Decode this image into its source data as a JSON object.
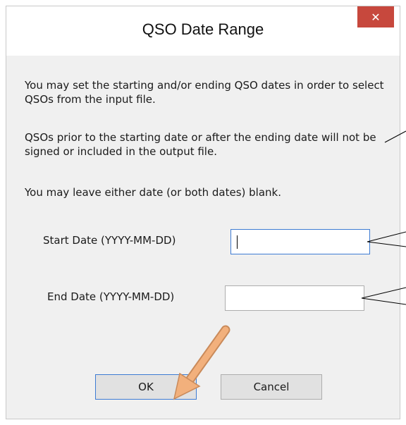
{
  "dialog": {
    "title": "QSO Date Range",
    "close_icon": "close-icon",
    "intro": "You may set the starting and/or ending QSO dates in order to select QSOs from the input file.",
    "explanation": "QSOs prior to the starting date or after the ending date will not be signed or included in the output file.",
    "note": "You may leave either date (or both dates) blank.",
    "start_date": {
      "label": "Start Date (YYYY-MM-DD)",
      "value": ""
    },
    "end_date": {
      "label": "End Date (YYYY-MM-DD)",
      "value": ""
    },
    "ok_label": "OK",
    "cancel_label": "Cancel"
  },
  "colors": {
    "close_button": "#c7483d",
    "arrow": "#f0b07a",
    "focus_border": "#3d7bd3"
  }
}
